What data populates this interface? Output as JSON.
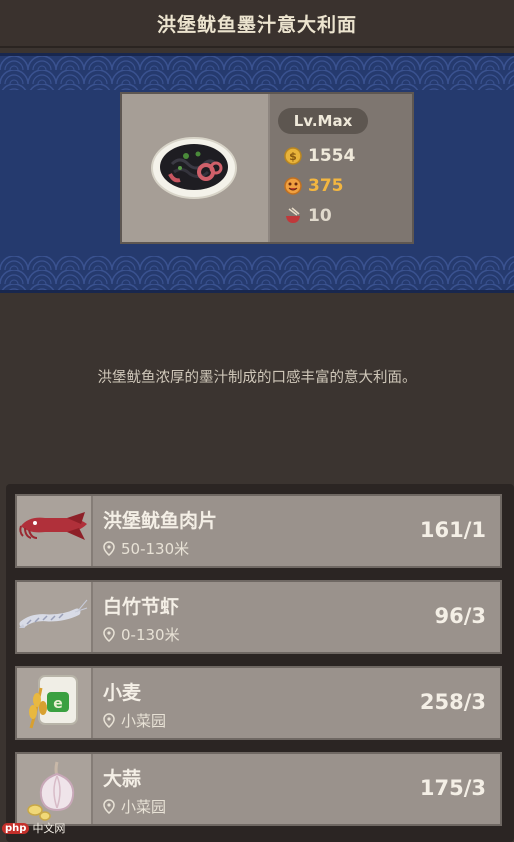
{
  "title": "洪堡鱿鱼墨汁意大利面",
  "dish": {
    "level": "Lv.Max",
    "coins": "1554",
    "flavor": "375",
    "bowls": "10",
    "icon": "squid-ink-pasta-plate"
  },
  "description": "洪堡鱿鱼浓厚的墨汁制成的口感丰富的意大利面。",
  "ingredients": [
    {
      "name": "洪堡鱿鱼肉片",
      "location": "50-130米",
      "quantity": "161/1",
      "icon": "squid-icon"
    },
    {
      "name": "白竹节虾",
      "location": "0-130米",
      "quantity": "96/3",
      "icon": "shrimp-icon"
    },
    {
      "name": "小麦",
      "location": "小菜园",
      "quantity": "258/3",
      "icon": "wheat-bag-icon"
    },
    {
      "name": "大蒜",
      "location": "小菜园",
      "quantity": "175/3",
      "icon": "garlic-icon"
    }
  ],
  "watermark": {
    "logo": "php",
    "text": "中文网"
  },
  "colors": {
    "banner": "#253a6e",
    "coin": "#e8b33a",
    "flavor": "#f3b640",
    "row": "#9a928c"
  }
}
